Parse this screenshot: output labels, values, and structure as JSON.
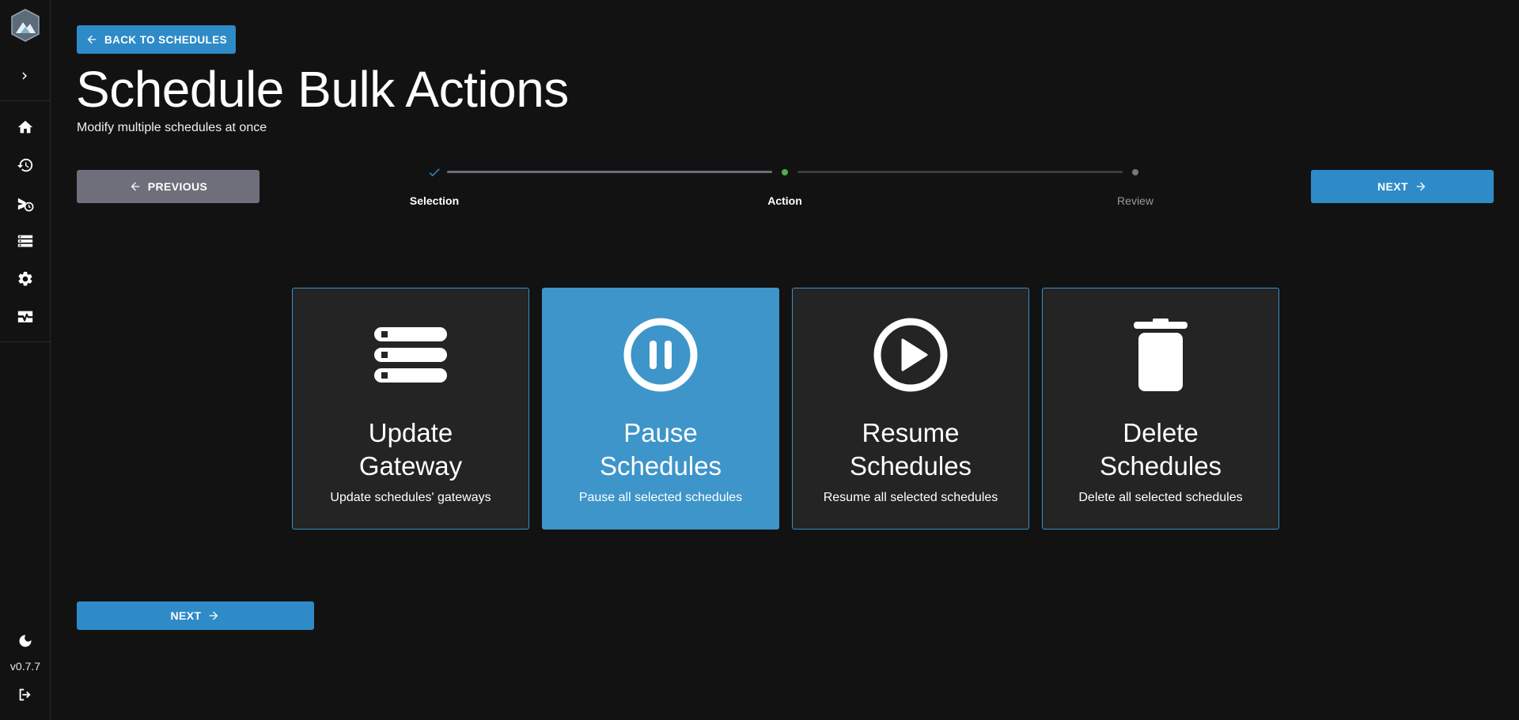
{
  "app": {
    "version": "v0.7.7"
  },
  "sidebar": {
    "items": [
      {
        "icon": "home-icon"
      },
      {
        "icon": "history-icon"
      },
      {
        "icon": "schedule-send-icon"
      },
      {
        "icon": "storage-icon"
      },
      {
        "icon": "gear-icon"
      },
      {
        "icon": "monitor-heart-icon"
      }
    ]
  },
  "header": {
    "back_label": "BACK TO SCHEDULES",
    "title": "Schedule Bulk Actions",
    "subtitle": "Modify multiple schedules at once"
  },
  "nav": {
    "previous_label": "PREVIOUS",
    "next_label": "NEXT",
    "bottom_next_label": "NEXT"
  },
  "stepper": {
    "steps": [
      {
        "label": "Selection",
        "state": "completed"
      },
      {
        "label": "Action",
        "state": "active"
      },
      {
        "label": "Review",
        "state": "pending"
      }
    ]
  },
  "actions": [
    {
      "title": "Update Gateway",
      "description": "Update schedules' gateways",
      "icon": "storage-icon",
      "selected": false
    },
    {
      "title": "Pause Schedules",
      "description": "Pause all selected schedules",
      "icon": "pause-circle-icon",
      "selected": true
    },
    {
      "title": "Resume Schedules",
      "description": "Resume all selected schedules",
      "icon": "play-circle-icon",
      "selected": false
    },
    {
      "title": "Delete Schedules",
      "description": "Delete all selected schedules",
      "icon": "trash-icon",
      "selected": false
    }
  ],
  "colors": {
    "accent": "#2e8bc8",
    "selected_card": "#3e95c9",
    "step_active": "#4caf50",
    "background": "#121213"
  }
}
